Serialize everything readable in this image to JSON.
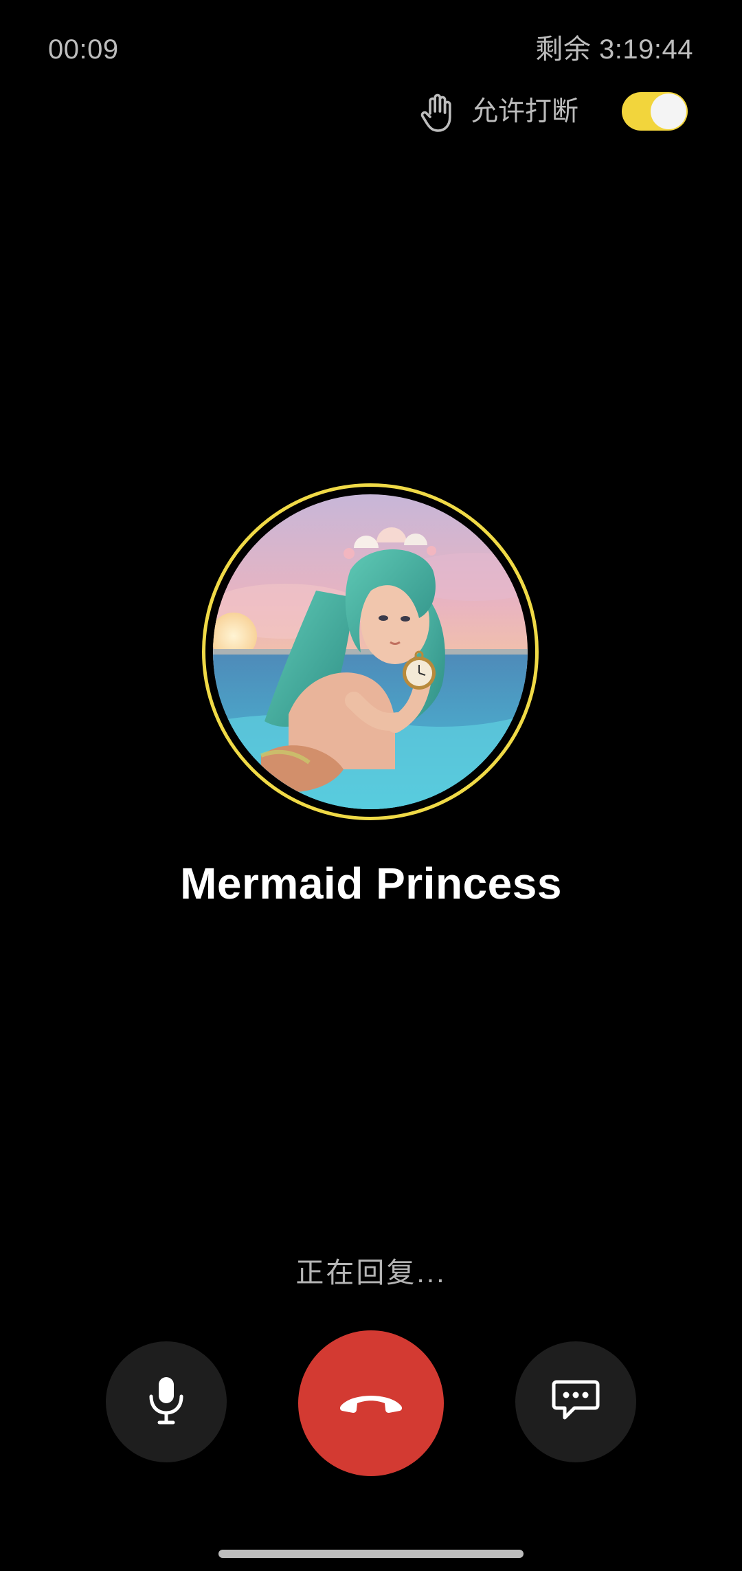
{
  "call": {
    "elapsed": "00:09",
    "remaining": "剩余 3:19:44",
    "status": "正在回复..."
  },
  "interrupt": {
    "label": "允许打断",
    "enabled": true,
    "icon": "hand-icon"
  },
  "contact": {
    "name": "Mermaid Princess",
    "avatar": "mermaid-avatar"
  },
  "controls": {
    "mic_icon": "microphone-icon",
    "hangup_icon": "hang-up-phone-icon",
    "chat_icon": "chat-bubble-icon"
  },
  "colors": {
    "background": "#000000",
    "accent": "#f2d53c",
    "hangup": "#d33a32",
    "control_bg": "#1e1e1e",
    "muted_text": "#bdbdbd"
  }
}
